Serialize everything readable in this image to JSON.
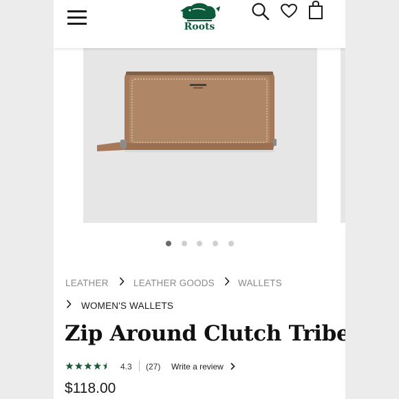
{
  "header": {
    "logo_text": "Roots",
    "icons": [
      "menu-icon",
      "search-icon",
      "heart-icon",
      "shopping-bag-icon"
    ],
    "brand_color": "#0b5a3c"
  },
  "gallery": {
    "image": "tan leather zip-around wallet",
    "slide_count": 5,
    "active_slide": 1
  },
  "breadcrumb": {
    "items": [
      "LEATHER",
      "LEATHER GOODS",
      "WALLETS",
      "WOMEN'S WALLETS"
    ]
  },
  "product": {
    "title": "Zip Around Clutch Tribe",
    "rating_value": "4.3",
    "rating_stars": 4.5,
    "review_count": "(27)",
    "write_review_label": "Write a review",
    "price": "$118.00",
    "star_color": "#1f5a3a"
  }
}
